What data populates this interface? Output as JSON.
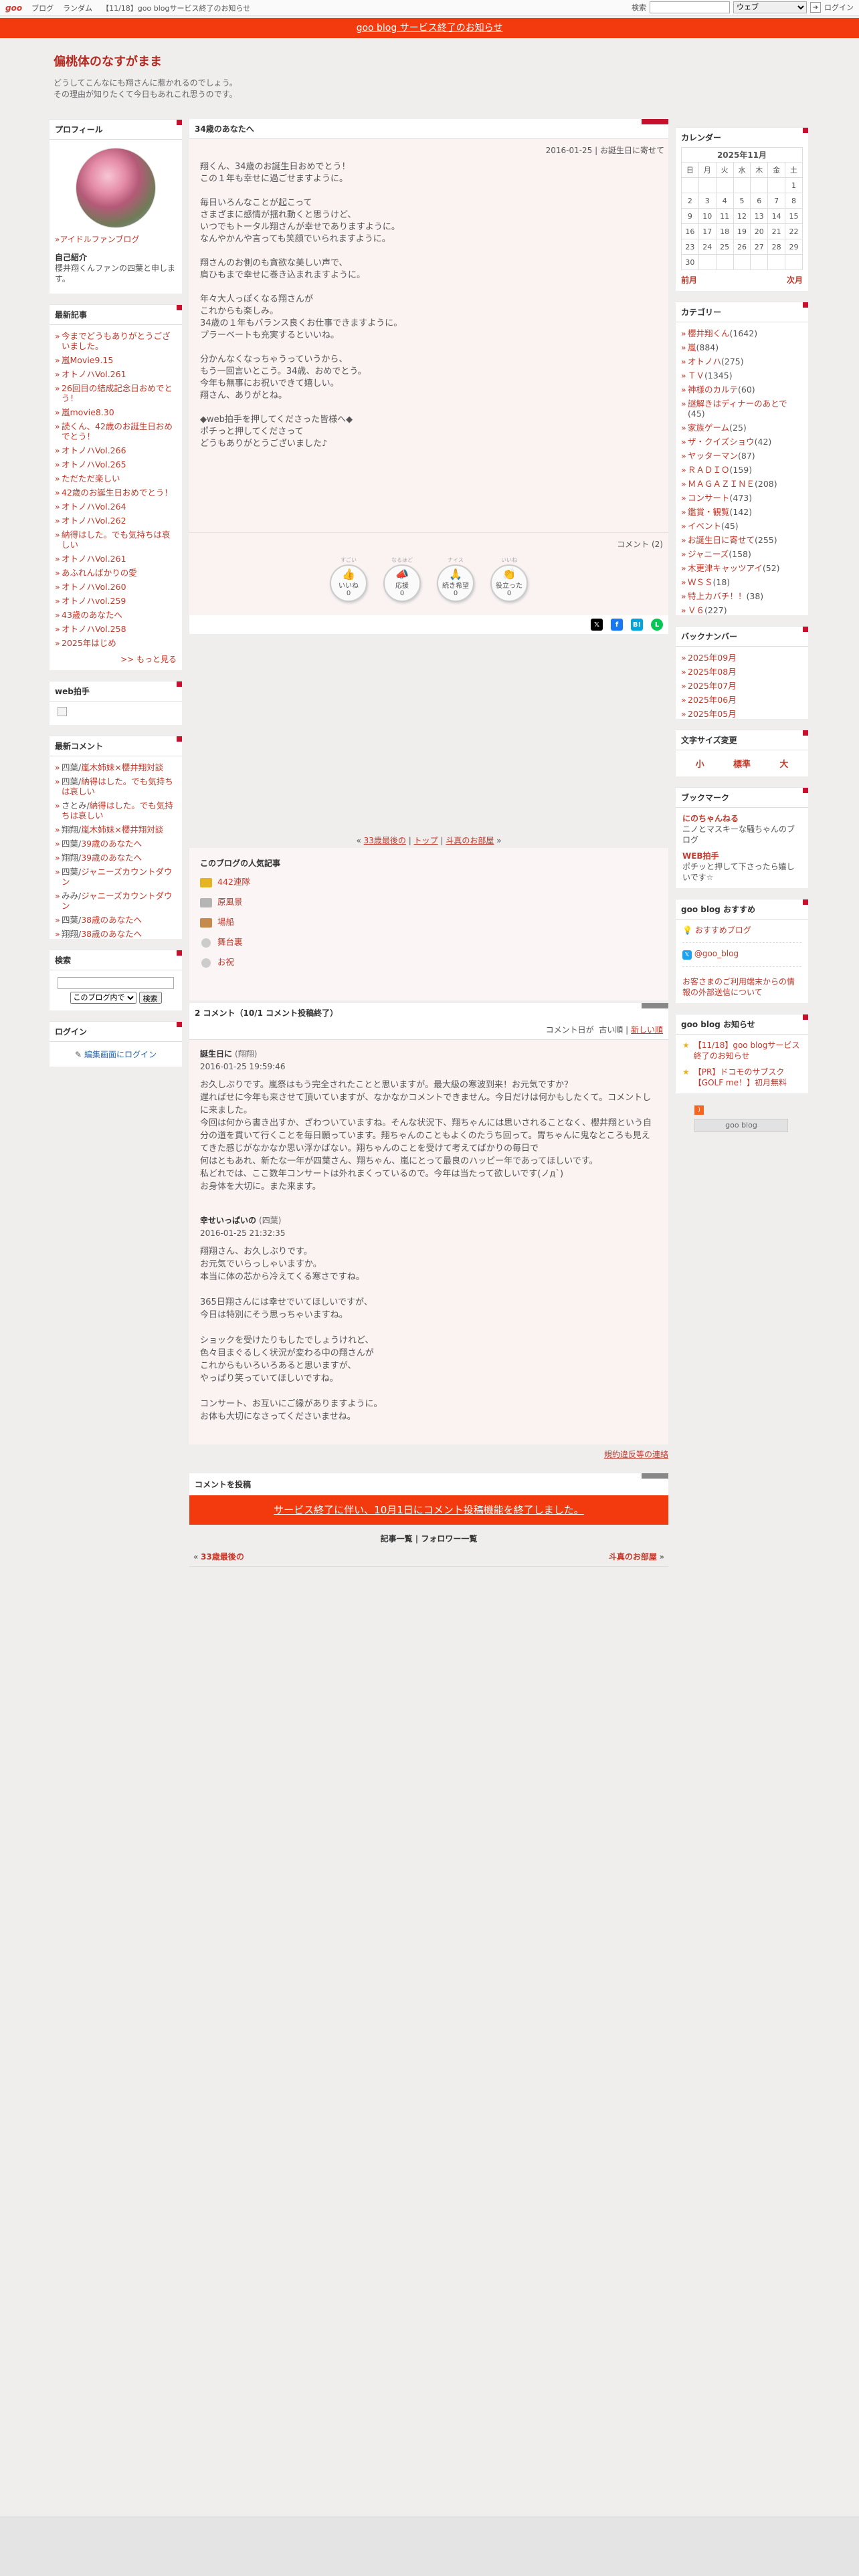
{
  "global_header": {
    "logo": "goo",
    "links": [
      "ブログ",
      "ランダム",
      "【11/18】goo blogサービス終了のお知らせ"
    ],
    "search_label": "検索",
    "search_select": "ウェブ",
    "login": "ログイン"
  },
  "notice": "goo blog サービス終了のお知らせ",
  "blog": {
    "title": "偏桃体のなすがまま",
    "description_line1": "どうしてこんなにも翔さんに惹かれるのでしょう。",
    "description_line2": "その理由が知りたくて今日もあれこれ思うのです。"
  },
  "profile": {
    "header": "プロフィール",
    "fan_link": "アイドルファンブログ",
    "intro_label": "自己紹介",
    "intro_text": "櫻井翔くんファンの四葉と申します。"
  },
  "recent_posts": {
    "header": "最新記事",
    "items": [
      "今までどうもありがとうございました。",
      "嵐Movie9.15",
      "オトノハVol.261",
      "26回目の結成記念日おめでとう！",
      "嵐movie8.30",
      "読くん、42歳のお誕生日おめでとう！",
      "オトノハVol.266",
      "オトノハVol.265",
      "ただただ楽しい",
      "42歳のお誕生日おめでとう！",
      "オトノハVol.264",
      "オトノハVol.262",
      "納得はした。でも気持ちは哀しい",
      "オトノハVol.261",
      "あふれんばかりの愛",
      "オトノハVol.260",
      "オトノハvol.259",
      "43歳のあなたへ",
      "オトノハVol.258",
      "2025年はじめ"
    ],
    "more": ">> もっと見る"
  },
  "web_clap": {
    "header": "web拍手"
  },
  "recent_comments": {
    "header": "最新コメント",
    "items": [
      {
        "name": "四葉",
        "title": "嵐木姉妹×櫻井翔対談"
      },
      {
        "name": "四葉",
        "title": "納得はした。でも気持ちは哀しい"
      },
      {
        "name": "さとみ",
        "title": "納得はした。でも気持ちは哀しい"
      },
      {
        "name": "翔翔",
        "title": "嵐木姉妹×櫻井翔対談"
      },
      {
        "name": "四葉",
        "title": "39歳のあなたへ"
      },
      {
        "name": "翔翔",
        "title": "39歳のあなたへ"
      },
      {
        "name": "四葉",
        "title": "ジャニーズカウントダウン"
      },
      {
        "name": "みみ",
        "title": "ジャニーズカウントダウン"
      },
      {
        "name": "四葉",
        "title": "38歳のあなたへ"
      },
      {
        "name": "翔翔",
        "title": "38歳のあなたへ"
      }
    ]
  },
  "search_box": {
    "header": "検索",
    "select": "このブログ内で",
    "button": "検索"
  },
  "login_box": {
    "header": "ログイン",
    "link": "編集画面にログイン"
  },
  "article": {
    "title": "34歳のあなたへ",
    "meta": "2016-01-25 | お誕生日に寄せて",
    "paragraphs": [
      [
        "翔くん、34歳のお誕生日おめでとう！",
        "この１年も幸せに過ごせますように。"
      ],
      [
        "毎日いろんなことが起こって",
        "さまざまに感情が揺れ動くと思うけど、",
        "いつでもトータル翔さんが幸せでありますように。",
        "なんやかんや言っても笑顔でいられますように。"
      ],
      [
        "翔さんのお側のも貪欲な美しい声で、",
        "肩ひもまで幸せに巻き込まれますように。"
      ],
      [
        "年々大人っぽくなる翔さんが",
        "これからも楽しみ。",
        "34歳の１年もバランス良くお仕事できますように。",
        "プラーベートも充実するといいね。"
      ],
      [
        "分かんなくなっちゃうっていうから、",
        "もう一回言いとこう。34歳、おめでとう。",
        "今年も無事にお祝いできて嬉しい。",
        "翔さん、ありがとね。"
      ],
      [
        "◆web拍手を押してくださった皆様へ◆",
        "ポチっと押してくださって",
        "どうもありがとうございました♪"
      ]
    ],
    "comment_count": "コメント (2)",
    "stamps": [
      {
        "top": "すごい",
        "label": "いいね",
        "count": "0"
      },
      {
        "top": "なるほど",
        "label": "応援",
        "count": "0"
      },
      {
        "top": "ナイス",
        "label": "続き希望",
        "count": "0"
      },
      {
        "top": "いいね",
        "label": "役立った",
        "count": "0"
      }
    ],
    "nav": {
      "prev": "33歳最後の",
      "sep1": "|",
      "top": "トップ",
      "sep2": "|",
      "next": "斗真のお部屋"
    }
  },
  "popular": {
    "header": "このブログの人気記事",
    "items": [
      "442連隊",
      "原風景",
      "場船",
      "舞台裏",
      "お祝"
    ]
  },
  "comments": {
    "header": "2 コメント（10/1 コメント投稿終了）",
    "order_label": "コメント日が",
    "order_old": "古い順",
    "order_new": "新しい順",
    "items": [
      {
        "name": "誕生日に",
        "sub": "(翔翔)",
        "date": "2016-01-25 19:59:46",
        "body": [
          "お久しぶりです。嵐祭はもう完全されたことと思いますが。最大級の寒波到来！お元気ですか？",
          "遅ればせに今年も来させて頂いていますが、なかなかコメントできません。今日だけは何かもしたくて。コメントしに来ました。",
          "今回は何から書き出すか、ざわついていますね。そんな状況下、翔ちゃんには思いされることなく、櫻井翔という自分の道を貫いて行くことを毎日願っています。翔ちゃんのこともよくのたうち回って。胃ちゃんに鬼なところも見えてきた感じがなかなか思い浮かばない。翔ちゃんのことを受けて考えてばかりの毎日で",
          "何はともあれ、新たな一年が四葉さん、翔ちゃん、嵐にとって最良のハッピー年であってほしいです。",
          "私どれでは、ここ数年コンサートは外れまくっているので。今年は当たって欲しいです(ノд`)",
          "お身体を大切に。また来ます。"
        ]
      },
      {
        "name": "幸せいっぱいの",
        "sub": "(四葉)",
        "date": "2016-01-25 21:32:35",
        "body": [
          "翔翔さん、お久しぶりです。",
          "お元気でいらっしゃいますか。",
          "本当に体の芯から冷えてくる寒さですね。",
          "",
          "365日翔さんには幸せでいてほしいですが、",
          "今日は特別にそう思っちゃいますね。",
          "",
          "ショックを受けたりもしたでしょうけれど、",
          "色々目まぐるしく状況が変わる中の翔さんが",
          "これからもいろいろあると思いますが、",
          "やっぱり笑っていてほしいですね。",
          "",
          "コンサート、お互いにご縁がありますように。",
          "お体も大切になさってくださいませね。"
        ]
      }
    ],
    "terms_link": "規約違反等の連絡"
  },
  "comment_post": {
    "header": "コメントを投稿",
    "notice": "サービス終了に伴い、10月1日にコメント投稿機能を終了しました。",
    "links": [
      "記事一覧",
      "|",
      "フォロワー一覧"
    ],
    "prev": "33歳最後の",
    "next": "斗真のお部屋"
  },
  "calendar": {
    "header": "カレンダー",
    "month": "2025年11月",
    "weekdays": [
      "日",
      "月",
      "火",
      "水",
      "木",
      "金",
      "土"
    ],
    "weeks": [
      [
        "",
        "",
        "",
        "",
        "",
        "",
        "1"
      ],
      [
        "2",
        "3",
        "4",
        "5",
        "6",
        "7",
        "8"
      ],
      [
        "9",
        "10",
        "11",
        "12",
        "13",
        "14",
        "15"
      ],
      [
        "16",
        "17",
        "18",
        "19",
        "20",
        "21",
        "22"
      ],
      [
        "23",
        "24",
        "25",
        "26",
        "27",
        "28",
        "29"
      ],
      [
        "30",
        "",
        "",
        "",
        "",
        "",
        ""
      ]
    ],
    "prev": "前月",
    "next": "次月"
  },
  "categories": {
    "header": "カテゴリー",
    "items": [
      {
        "name": "櫻井翔くん",
        "count": "(1642)"
      },
      {
        "name": "嵐",
        "count": "(884)"
      },
      {
        "name": "オトノハ",
        "count": "(275)"
      },
      {
        "name": "ＴＶ",
        "count": "(1345)"
      },
      {
        "name": "神様のカルテ",
        "count": "(60)"
      },
      {
        "name": "謎解きはディナーのあとで",
        "count": "(45)"
      },
      {
        "name": "家族ゲーム",
        "count": "(25)"
      },
      {
        "name": "ザ・クイズショウ",
        "count": "(42)"
      },
      {
        "name": "ヤッターマン",
        "count": "(87)"
      },
      {
        "name": "ＲＡＤＩＯ",
        "count": "(159)"
      },
      {
        "name": "ＭＡＧＡＺＩＮＥ",
        "count": "(208)"
      },
      {
        "name": "コンサート",
        "count": "(473)"
      },
      {
        "name": "鑑賞・観覧",
        "count": "(142)"
      },
      {
        "name": "イベント",
        "count": "(45)"
      },
      {
        "name": "お誕生日に寄せて",
        "count": "(255)"
      },
      {
        "name": "ジャニーズ",
        "count": "(158)"
      },
      {
        "name": "木更津キャッツアイ",
        "count": "(52)"
      },
      {
        "name": "ＷＳＳ",
        "count": "(18)"
      },
      {
        "name": "特上カバチ！！",
        "count": "(38)"
      },
      {
        "name": "Ｖ６",
        "count": "(227)"
      }
    ]
  },
  "backnumber": {
    "header": "バックナンバー",
    "items": [
      "2025年09月",
      "2025年08月",
      "2025年07月",
      "2025年06月",
      "2025年05月"
    ]
  },
  "fontsize": {
    "header": "文字サイズ変更",
    "small": "小",
    "std": "標準",
    "large": "大"
  },
  "bookmark": {
    "header": "ブックマーク",
    "items": [
      {
        "title": "にのちゃんねる",
        "desc": "ニノとマスキーな騒ちゃんのブログ"
      },
      {
        "title": "WEB拍手",
        "desc": "ポチッと押して下さったら嬉しいです☆"
      }
    ]
  },
  "goo_recommend": {
    "header": "goo blog おすすめ",
    "rec": "おすすめブログ",
    "x": "@goo_blog",
    "contact": "お客さまのご利用端末からの情報の外部送信について"
  },
  "goo_news": {
    "header": "goo blog お知らせ",
    "items": [
      "【11/18】goo blogサービス終了のお知らせ",
      "【PR】ドコモのサブスク【GOLF me！】初月無料"
    ],
    "footer_logo": "goo blog"
  },
  "colors": {
    "accent": "#c8102e",
    "notice_bg": "#f33a0f",
    "link": "#c0392b"
  }
}
